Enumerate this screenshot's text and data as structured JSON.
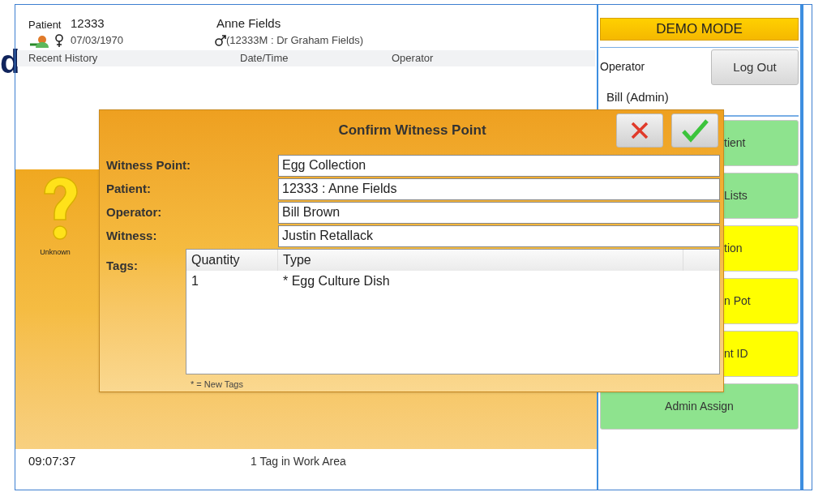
{
  "slide_fragment": "d",
  "patient": {
    "label": "Patient",
    "id": "12333",
    "name": "Anne Fields",
    "dob": "07/03/1970",
    "partner": "(12333M : Dr Graham Fields)"
  },
  "history": {
    "columns": [
      "Recent History",
      "Date/Time",
      "Operator"
    ]
  },
  "unknown_label": "Unknown",
  "status_bar": {
    "time": "09:07:37",
    "message": "1 Tag in Work Area"
  },
  "demo_banner": "DEMO MODE",
  "operator": {
    "label": "Operator",
    "name": "Bill (Admin)",
    "logout": "Log Out"
  },
  "actions": [
    {
      "label": "tient",
      "color": "#8ee38e",
      "hidden_part": true
    },
    {
      "label": "Lists",
      "color": "#8ee38e",
      "hidden_part": true
    },
    {
      "label": "tion",
      "color": "#ffff00",
      "hidden_part": true
    },
    {
      "label": "n Pot",
      "color": "#ffff00",
      "hidden_part": true
    },
    {
      "label": "nt ID",
      "color": "#ffff00",
      "hidden_part": true
    },
    {
      "label": "Admin Assign",
      "color": "#8ee38e",
      "hidden_part": false
    }
  ],
  "dialog": {
    "title": "Confirm Witness Point",
    "fields": [
      {
        "label": "Witness Point:",
        "value": "Egg Collection"
      },
      {
        "label": "Patient:",
        "value": "12333 : Anne Fields"
      },
      {
        "label": "Operator:",
        "value": "Bill Brown"
      },
      {
        "label": "Witness:",
        "value": "Justin Retallack"
      }
    ],
    "tags": {
      "label": "Tags:",
      "columns": [
        "Quantity",
        "Type"
      ],
      "rows": [
        [
          "1",
          "* Egg Culture Dish"
        ]
      ]
    },
    "footnote": "* = New Tags"
  }
}
